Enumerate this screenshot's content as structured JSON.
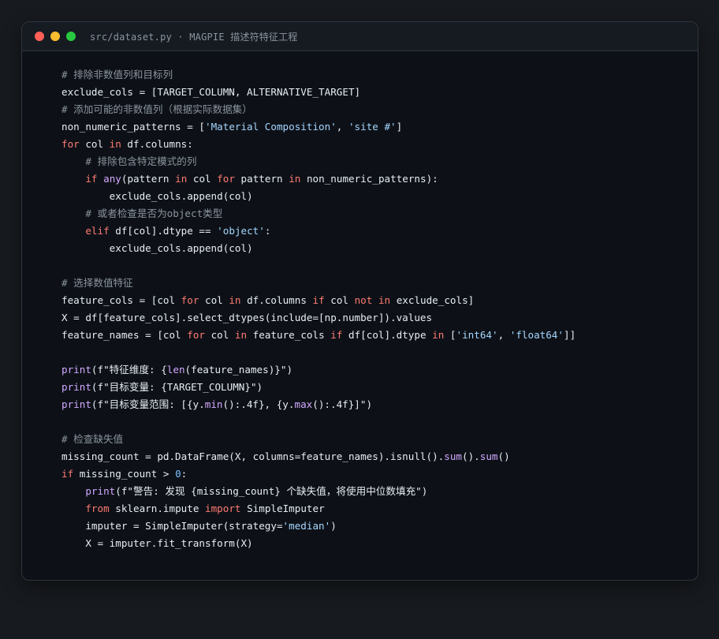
{
  "window": {
    "title": "src/dataset.py · MAGPIE 描述符特征工程",
    "controls": [
      {
        "name": "close-button",
        "color": "#ff5f57"
      },
      {
        "name": "minimize-button",
        "color": "#febc2e"
      },
      {
        "name": "maximize-button",
        "color": "#28c840"
      }
    ]
  },
  "theme": {
    "keyword": "#ff7b72",
    "builtin": "#d2a8ff",
    "string": "#a5d6ff",
    "number": "#79c0ff",
    "comment": "#8b949e",
    "plain": "#e6edf3"
  },
  "code": {
    "lines": [
      [
        [
          "comment",
          "# 排除非数值列和目标列"
        ]
      ],
      [
        [
          "plain",
          "exclude_cols = [TARGET_COLUMN, ALTERNATIVE_TARGET]"
        ]
      ],
      [
        [
          "comment",
          "# 添加可能的非数值列（根据实际数据集）"
        ]
      ],
      [
        [
          "plain",
          "non_numeric_patterns = ["
        ],
        [
          "string",
          "'Material Composition'"
        ],
        [
          "plain",
          ", "
        ],
        [
          "string",
          "'site #'"
        ],
        [
          "plain",
          "]"
        ]
      ],
      [
        [
          "keyword",
          "for"
        ],
        [
          "plain",
          " col "
        ],
        [
          "keyword",
          "in"
        ],
        [
          "plain",
          " df.columns:"
        ]
      ],
      [
        [
          "plain",
          "    "
        ],
        [
          "comment",
          "# 排除包含特定模式的列"
        ]
      ],
      [
        [
          "plain",
          "    "
        ],
        [
          "keyword",
          "if"
        ],
        [
          "plain",
          " "
        ],
        [
          "builtin",
          "any"
        ],
        [
          "plain",
          "(pattern "
        ],
        [
          "keyword",
          "in"
        ],
        [
          "plain",
          " col "
        ],
        [
          "keyword",
          "for"
        ],
        [
          "plain",
          " pattern "
        ],
        [
          "keyword",
          "in"
        ],
        [
          "plain",
          " non_numeric_patterns):"
        ]
      ],
      [
        [
          "plain",
          "        exclude_cols.append(col)"
        ]
      ],
      [
        [
          "plain",
          "    "
        ],
        [
          "comment",
          "# 或者检查是否为object类型"
        ]
      ],
      [
        [
          "plain",
          "    "
        ],
        [
          "keyword",
          "elif"
        ],
        [
          "plain",
          " df[col].dtype == "
        ],
        [
          "string",
          "'object'"
        ],
        [
          "plain",
          ":"
        ]
      ],
      [
        [
          "plain",
          "        exclude_cols.append(col)"
        ]
      ],
      [],
      [
        [
          "comment",
          "# 选择数值特征"
        ]
      ],
      [
        [
          "plain",
          "feature_cols = [col "
        ],
        [
          "keyword",
          "for"
        ],
        [
          "plain",
          " col "
        ],
        [
          "keyword",
          "in"
        ],
        [
          "plain",
          " df.columns "
        ],
        [
          "keyword",
          "if"
        ],
        [
          "plain",
          " col "
        ],
        [
          "keyword",
          "not"
        ],
        [
          "plain",
          " "
        ],
        [
          "keyword",
          "in"
        ],
        [
          "plain",
          " exclude_cols]"
        ]
      ],
      [
        [
          "plain",
          "X = df[feature_cols].select_dtypes(include=[np.number]).values"
        ]
      ],
      [
        [
          "plain",
          "feature_names = [col "
        ],
        [
          "keyword",
          "for"
        ],
        [
          "plain",
          " col "
        ],
        [
          "keyword",
          "in"
        ],
        [
          "plain",
          " feature_cols "
        ],
        [
          "keyword",
          "if"
        ],
        [
          "plain",
          " df[col].dtype "
        ],
        [
          "keyword",
          "in"
        ],
        [
          "plain",
          " ["
        ],
        [
          "string",
          "'int64'"
        ],
        [
          "plain",
          ", "
        ],
        [
          "string",
          "'float64'"
        ],
        [
          "plain",
          "]]"
        ]
      ],
      [],
      [
        [
          "builtin",
          "print"
        ],
        [
          "plain",
          "(f\"特征维度: {"
        ],
        [
          "builtin",
          "len"
        ],
        [
          "plain",
          "(feature_names)}\")"
        ]
      ],
      [
        [
          "builtin",
          "print"
        ],
        [
          "plain",
          "(f\"目标变量: {TARGET_COLUMN}\")"
        ]
      ],
      [
        [
          "builtin",
          "print"
        ],
        [
          "plain",
          "(f\"目标变量范围: [{y."
        ],
        [
          "builtin",
          "min"
        ],
        [
          "plain",
          "():.4f}, {y."
        ],
        [
          "builtin",
          "max"
        ],
        [
          "plain",
          "():.4f}]\")"
        ]
      ],
      [],
      [
        [
          "comment",
          "# 检查缺失值"
        ]
      ],
      [
        [
          "plain",
          "missing_count = pd.DataFrame(X, columns=feature_names).isnull()."
        ],
        [
          "builtin",
          "sum"
        ],
        [
          "plain",
          "()."
        ],
        [
          "builtin",
          "sum"
        ],
        [
          "plain",
          "()"
        ]
      ],
      [
        [
          "keyword",
          "if"
        ],
        [
          "plain",
          " missing_count > "
        ],
        [
          "number",
          "0"
        ],
        [
          "plain",
          ":"
        ]
      ],
      [
        [
          "plain",
          "    "
        ],
        [
          "builtin",
          "print"
        ],
        [
          "plain",
          "(f\"警告: 发现 {missing_count} 个缺失值，将使用中位数填充\")"
        ]
      ],
      [
        [
          "plain",
          "    "
        ],
        [
          "keyword",
          "from"
        ],
        [
          "plain",
          " sklearn.impute "
        ],
        [
          "keyword",
          "import"
        ],
        [
          "plain",
          " SimpleImputer"
        ]
      ],
      [
        [
          "plain",
          "    imputer = SimpleImputer(strategy="
        ],
        [
          "string",
          "'median'"
        ],
        [
          "plain",
          ")"
        ]
      ],
      [
        [
          "plain",
          "    X = imputer.fit_transform(X)"
        ]
      ]
    ]
  }
}
